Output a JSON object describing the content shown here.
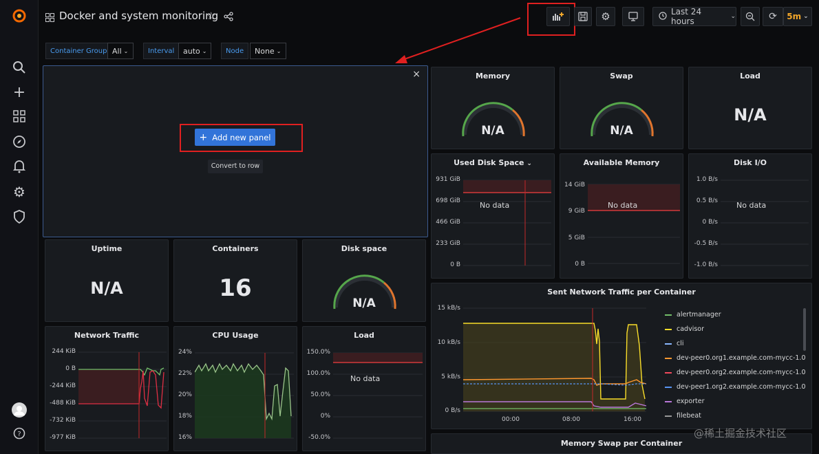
{
  "header": {
    "title": "Docker and system monitoring",
    "time_range": "Last 24 hours",
    "refresh": "5m"
  },
  "variables": [
    {
      "label": "Container Group",
      "value": "All"
    },
    {
      "label": "Interval",
      "value": "auto"
    },
    {
      "label": "Node",
      "value": "None"
    }
  ],
  "new_panel": {
    "add_label": "Add new panel",
    "convert_label": "Convert to row",
    "close": "×"
  },
  "panels": {
    "memory": {
      "title": "Memory",
      "value": "N/A"
    },
    "swap": {
      "title": "Swap",
      "value": "N/A"
    },
    "load_stat": {
      "title": "Load",
      "value": "N/A"
    },
    "uptime": {
      "title": "Uptime",
      "value": "N/A"
    },
    "containers": {
      "title": "Containers",
      "value": "16"
    },
    "disk_space": {
      "title": "Disk space",
      "value": "N/A"
    },
    "used_disk": {
      "title": "Used Disk Space",
      "nodata": "No data",
      "yticks": [
        "931 GiB",
        "698 GiB",
        "466 GiB",
        "233 GiB",
        "0 B"
      ]
    },
    "avail_mem": {
      "title": "Available Memory",
      "nodata": "No data",
      "yticks": [
        "14 GiB",
        "9 GiB",
        "5 GiB",
        "0 B"
      ]
    },
    "disk_io": {
      "title": "Disk I/O",
      "nodata": "No data",
      "yticks": [
        "1.0 B/s",
        "0.5 B/s",
        "0 B/s",
        "-0.5 B/s",
        "-1.0 B/s"
      ]
    },
    "net_traffic": {
      "title": "Network Traffic",
      "yticks": [
        "244 KiB",
        "0 B",
        "-244 KiB",
        "-488 KiB",
        "-732 KiB",
        "-977 KiB"
      ]
    },
    "cpu": {
      "title": "CPU Usage",
      "yticks": [
        "24%",
        "22%",
        "20%",
        "18%",
        "16%"
      ]
    },
    "load_graph": {
      "title": "Load",
      "nodata": "No data",
      "yticks": [
        "150.0%",
        "100.0%",
        "50.0%",
        "0%",
        "-50.0%"
      ]
    },
    "sent_net": {
      "title": "Sent Network Traffic per Container",
      "yticks": [
        "15 kB/s",
        "10 kB/s",
        "5 kB/s",
        "0 B/s"
      ],
      "xticks": [
        "00:00",
        "08:00",
        "16:00"
      ]
    },
    "mem_swap": {
      "title": "Memory Swap per Container"
    }
  },
  "legend": [
    {
      "name": "alertmanager",
      "color": "#73bf69"
    },
    {
      "name": "cadvisor",
      "color": "#fade2a"
    },
    {
      "name": "cli",
      "color": "#8ab8ff"
    },
    {
      "name": "dev-peer0.org1.example.com-mycc-1.0",
      "color": "#ff9830"
    },
    {
      "name": "dev-peer0.org2.example.com-mycc-1.0",
      "color": "#f2495c"
    },
    {
      "name": "dev-peer1.org2.example.com-mycc-1.0",
      "color": "#5794f2"
    },
    {
      "name": "exporter",
      "color": "#b877d9"
    },
    {
      "name": "filebeat",
      "color": "#999999"
    }
  ],
  "watermark": "@稀土掘金技术社区"
}
